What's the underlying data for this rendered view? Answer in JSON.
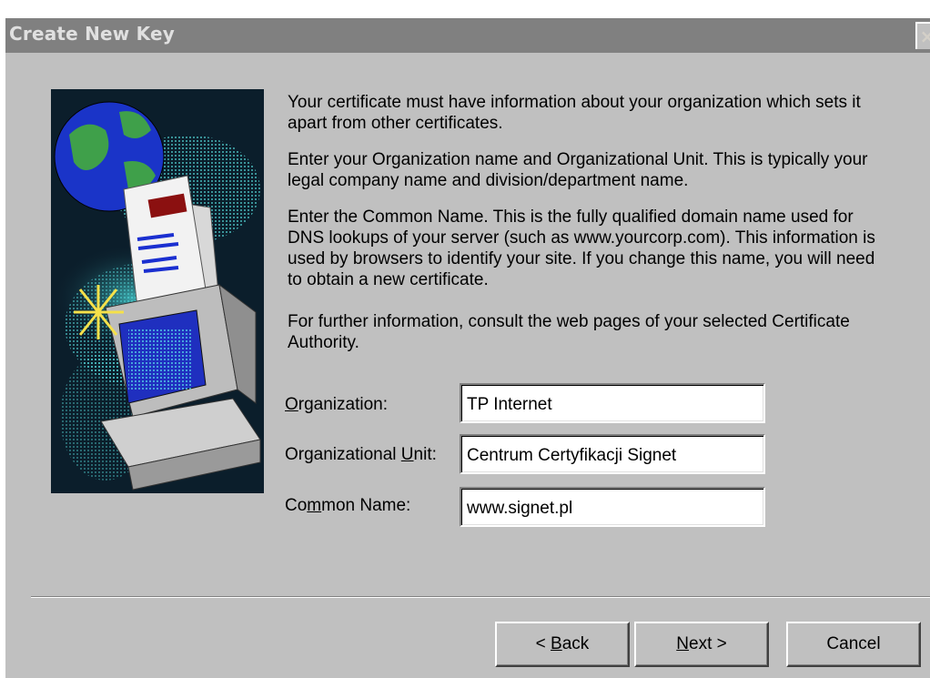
{
  "window": {
    "title": "Create New Key",
    "close_glyph": "×"
  },
  "illustration": {
    "description_icon": "certificate-globe-computer-illustration"
  },
  "description": {
    "p1": "Your certificate must have information about your organization which sets it apart from other certificates.",
    "p2": "Enter your Organization name and Organizational Unit. This is typically your legal company name and division/department name.",
    "p3": "Enter the Common Name. This is the fully qualified domain name used for DNS lookups of your server (such as www.yourcorp.com). This information is used by browsers to identify your site. If you change this name, you will need to obtain a new certificate.",
    "p4": "For further information, consult the web pages of your selected Certificate Authority."
  },
  "fields": {
    "organization": {
      "label_hot": "O",
      "label_rest": "rganization:",
      "value": "TP Internet"
    },
    "unit": {
      "label_pre": "Organizational ",
      "label_hot": "U",
      "label_rest": "nit:",
      "value": "Centrum Certyfikacji Signet"
    },
    "common_name": {
      "label_pre": "Co",
      "label_hot": "m",
      "label_rest": "mon Name:",
      "value": "www.signet.pl"
    }
  },
  "buttons": {
    "back": {
      "prefix": "< ",
      "hot": "B",
      "rest": "ack"
    },
    "next": {
      "hot": "N",
      "rest": "ext >"
    },
    "cancel": {
      "label": "Cancel"
    }
  },
  "colors": {
    "face": "#c0c0c0",
    "titlebar_inactive": "#808080",
    "art_background": "#0b1e2b"
  }
}
